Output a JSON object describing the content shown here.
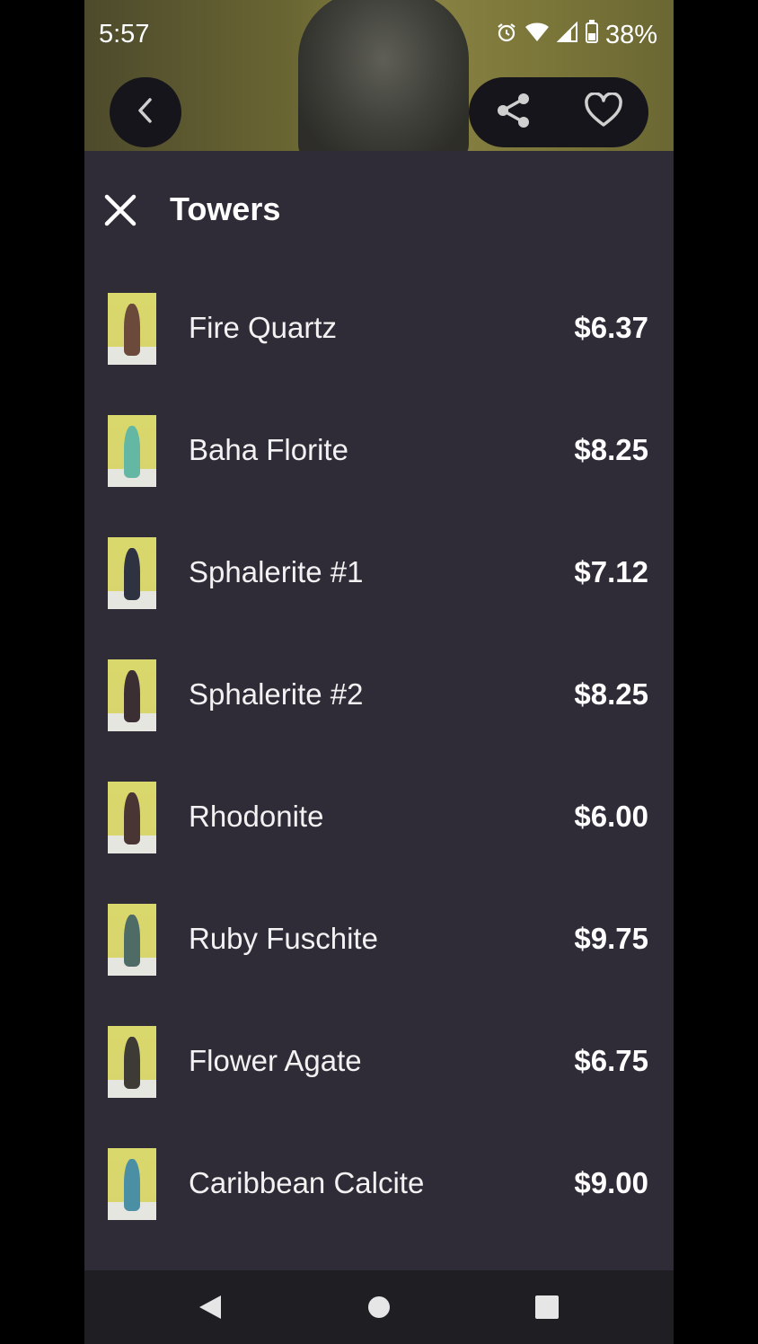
{
  "status_bar": {
    "time": "5:57",
    "battery": "38%"
  },
  "sheet": {
    "title": "Towers"
  },
  "items": [
    {
      "name": "Fire Quartz",
      "price": "$6.37",
      "crystal_color": "#6b4a3c"
    },
    {
      "name": "Baha Florite",
      "price": "$8.25",
      "crystal_color": "#63b7a3"
    },
    {
      "name": "Sphalerite #1",
      "price": "$7.12",
      "crystal_color": "#2f3240"
    },
    {
      "name": "Sphalerite #2",
      "price": "$8.25",
      "crystal_color": "#3b2f34"
    },
    {
      "name": "Rhodonite",
      "price": "$6.00",
      "crystal_color": "#4a3535"
    },
    {
      "name": "Ruby Fuschite",
      "price": "$9.75",
      "crystal_color": "#4f6b66"
    },
    {
      "name": "Flower Agate",
      "price": "$6.75",
      "crystal_color": "#3e3a35"
    },
    {
      "name": "Caribbean Calcite",
      "price": "$9.00",
      "crystal_color": "#4b8fa5"
    }
  ],
  "icons": {
    "back": "chevron-left-icon",
    "share": "share-icon",
    "favorite": "heart-icon",
    "close": "close-icon",
    "nav_back": "triangle-back-icon",
    "nav_home": "circle-home-icon",
    "nav_recents": "square-recents-icon"
  },
  "colors": {
    "sheet_background": "#2f2c38",
    "button_background": "#17151c",
    "text": "#ffffff"
  }
}
